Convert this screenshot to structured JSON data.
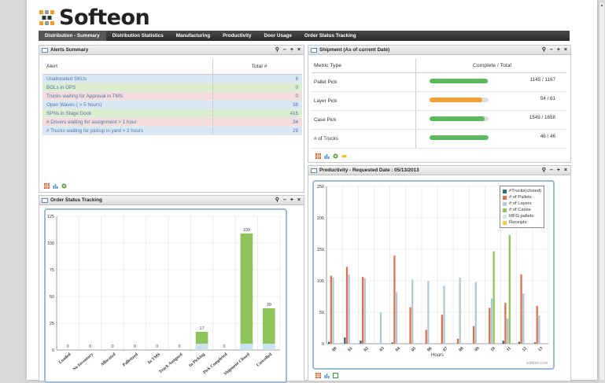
{
  "app": {
    "logo_text": "Softeon",
    "nav_tabs": [
      "Distribution - Summary",
      "Distribution Statistics",
      "Manufacturing",
      "Productivity",
      "Door Usage",
      "Order Status Tracking"
    ]
  },
  "panel_controls": [
    "⚲",
    "–",
    "+",
    "×"
  ],
  "alerts": {
    "title": "Alerts Summary",
    "col_alert": "Alert",
    "col_total": "Total #",
    "rows": [
      {
        "label": "Unallocated SKUs",
        "value": "8",
        "tone": "rb"
      },
      {
        "label": "BOLs in OPS",
        "value": "0",
        "tone": "rg"
      },
      {
        "label": "Trucks waiting for Approval in TMS",
        "value": "0",
        "tone": "rp"
      },
      {
        "label": "Open Waves ( > 5 hours)",
        "value": "38",
        "tone": "rb"
      },
      {
        "label": "SPNs in Stage Dock",
        "value": "415",
        "tone": "rg"
      },
      {
        "label": "# Drivers waiting for assignment > 1 hour",
        "value": "34",
        "tone": "rp"
      },
      {
        "label": "# Trucks waiting for pickup in yard > 2 hours",
        "value": "29",
        "tone": "rb"
      }
    ]
  },
  "shipment": {
    "title": "Shipment (As of current Date)",
    "col_metric": "Metric Type",
    "col_value": "Complete / Total",
    "rows": [
      {
        "label": "Pallet Pick",
        "value": "1145 / 1167",
        "progress": 0.98,
        "color": "#5cb85c"
      },
      {
        "label": "Layer Pick",
        "value": "54 / 61",
        "progress": 0.89,
        "color": "#f0a030"
      },
      {
        "label": "Case Pick",
        "value": "1549 / 1658",
        "progress": 0.93,
        "color": "#5cb85c"
      },
      {
        "label": "# of Trucks",
        "value": "46 / 46",
        "progress": 1.0,
        "color": "#5cb85c"
      }
    ]
  },
  "order_status": {
    "title": "Order Status Tracking",
    "chart_data": {
      "type": "bar",
      "categories": [
        "Loaded",
        "No Inventory",
        "Allocated",
        "Palletized",
        "In TMS",
        "Truck Assigned",
        "In Picking",
        "Pick Completed",
        "Shipment Closed",
        "Cancelled"
      ],
      "series": [
        {
          "values": [
            0,
            0,
            0,
            0,
            0,
            0,
            17,
            0,
            109,
            39
          ]
        }
      ],
      "data_labels": [
        "0",
        "0",
        "0",
        "0",
        "0",
        "0",
        "17",
        "0",
        "109",
        "39"
      ],
      "yticks": [
        "0",
        "25",
        "50",
        "75",
        "100",
        "125"
      ],
      "ylim": [
        0,
        125
      ],
      "grid": true,
      "bar_color": "#8fc45a",
      "base_color": "#c9e3ef"
    }
  },
  "productivity": {
    "title": "Productivity - Requested Date : 05/13/2013",
    "xlabel": "Hours",
    "watermark": "softeon.com",
    "chart_data": {
      "type": "bar",
      "categories": [
        "00",
        "01",
        "02",
        "03",
        "04",
        "05",
        "06",
        "07",
        "08",
        "09",
        "10",
        "11",
        "12",
        "13"
      ],
      "yticks": [
        "0",
        "50",
        "100",
        "150",
        "200",
        "250"
      ],
      "ylim": [
        0,
        250
      ],
      "xlabel": "Hours",
      "grid": true,
      "legend_position": "top-right",
      "series": [
        {
          "name": "#Trucks(closed)",
          "color": "#2e6e78",
          "values": [
            3,
            10,
            5,
            0,
            2,
            0,
            0,
            0,
            0,
            0,
            0,
            5,
            3,
            2
          ]
        },
        {
          "name": "# of Pallets",
          "color": "#e07050",
          "values": [
            108,
            122,
            106,
            0,
            140,
            58,
            22,
            46,
            8,
            28,
            57,
            65,
            110,
            60
          ]
        },
        {
          "name": "# of Layers",
          "color": "#b0c8d8",
          "values": [
            105,
            110,
            104,
            50,
            82,
            102,
            100,
            92,
            105,
            98,
            72,
            40,
            80,
            45
          ]
        },
        {
          "name": "# of Cases",
          "color": "#8fc45a",
          "values": [
            0,
            0,
            0,
            0,
            0,
            0,
            0,
            0,
            0,
            0,
            147,
            173,
            0,
            0
          ]
        },
        {
          "name": "MFG pallets",
          "color": "#cfe6f2",
          "values": [
            0,
            0,
            0,
            0,
            0,
            0,
            0,
            0,
            0,
            0,
            0,
            0,
            0,
            0
          ]
        },
        {
          "name": "Receipts",
          "color": "#f2d040",
          "values": [
            0,
            0,
            0,
            0,
            0,
            0,
            0,
            0,
            0,
            0,
            0,
            0,
            0,
            0
          ]
        }
      ]
    }
  }
}
